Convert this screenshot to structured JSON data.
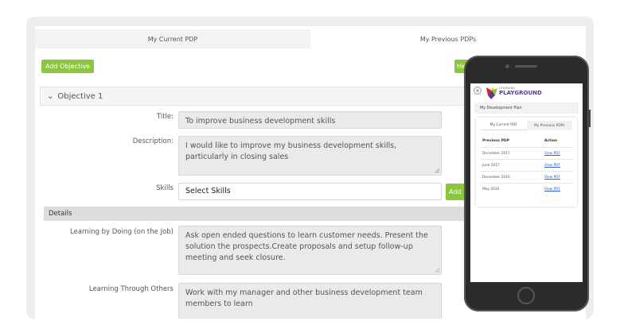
{
  "tabs": [
    {
      "label": "My Current PDP",
      "active": true
    },
    {
      "label": "My Previous PDPs",
      "active": false
    }
  ],
  "toolbar": {
    "add_objective": "Add Objective",
    "help_partial": "He"
  },
  "objective": {
    "header": "Objective 1",
    "title_label": "Title:",
    "title_value": "To improve business development skills",
    "description_label": "Description:",
    "description_value": "I would like to improve my business development skills, particularly in closing sales",
    "skills_label": "Skills",
    "skills_value": "Select Skills",
    "skills_add": "Add"
  },
  "details": {
    "heading": "Details",
    "doing_label": "Learning by Doing (on the Job)",
    "doing_value": "Ask open ended questions to learn customer needs. Present the solution the prospects.Create proposals and setup follow-up meeting and seek closure.",
    "others_label": "Learning Through Others",
    "others_value": " Work with my manager and other business development team members to learn"
  },
  "mobile": {
    "logo_small": "LEARNING",
    "logo_big": "PLAYGROUND",
    "close": "×",
    "plan_title": "My Development Plan",
    "tabs": [
      {
        "label": "My Current PDF",
        "active": true
      },
      {
        "label": "My Previous PDPs",
        "active": false
      }
    ],
    "col_previous": "Previous PDP",
    "col_action": "Action",
    "rows": [
      {
        "date": "December 2017",
        "action": "View PDF"
      },
      {
        "date": "June 2017",
        "action": "View PDF"
      },
      {
        "date": "December 2016",
        "action": "View PDF"
      },
      {
        "date": "May 2016",
        "action": "View PDF"
      }
    ]
  },
  "colors": {
    "accent_green": "#8cc63f",
    "link_blue": "#2b5cc4",
    "logo_purple": "#5a3d8a"
  }
}
